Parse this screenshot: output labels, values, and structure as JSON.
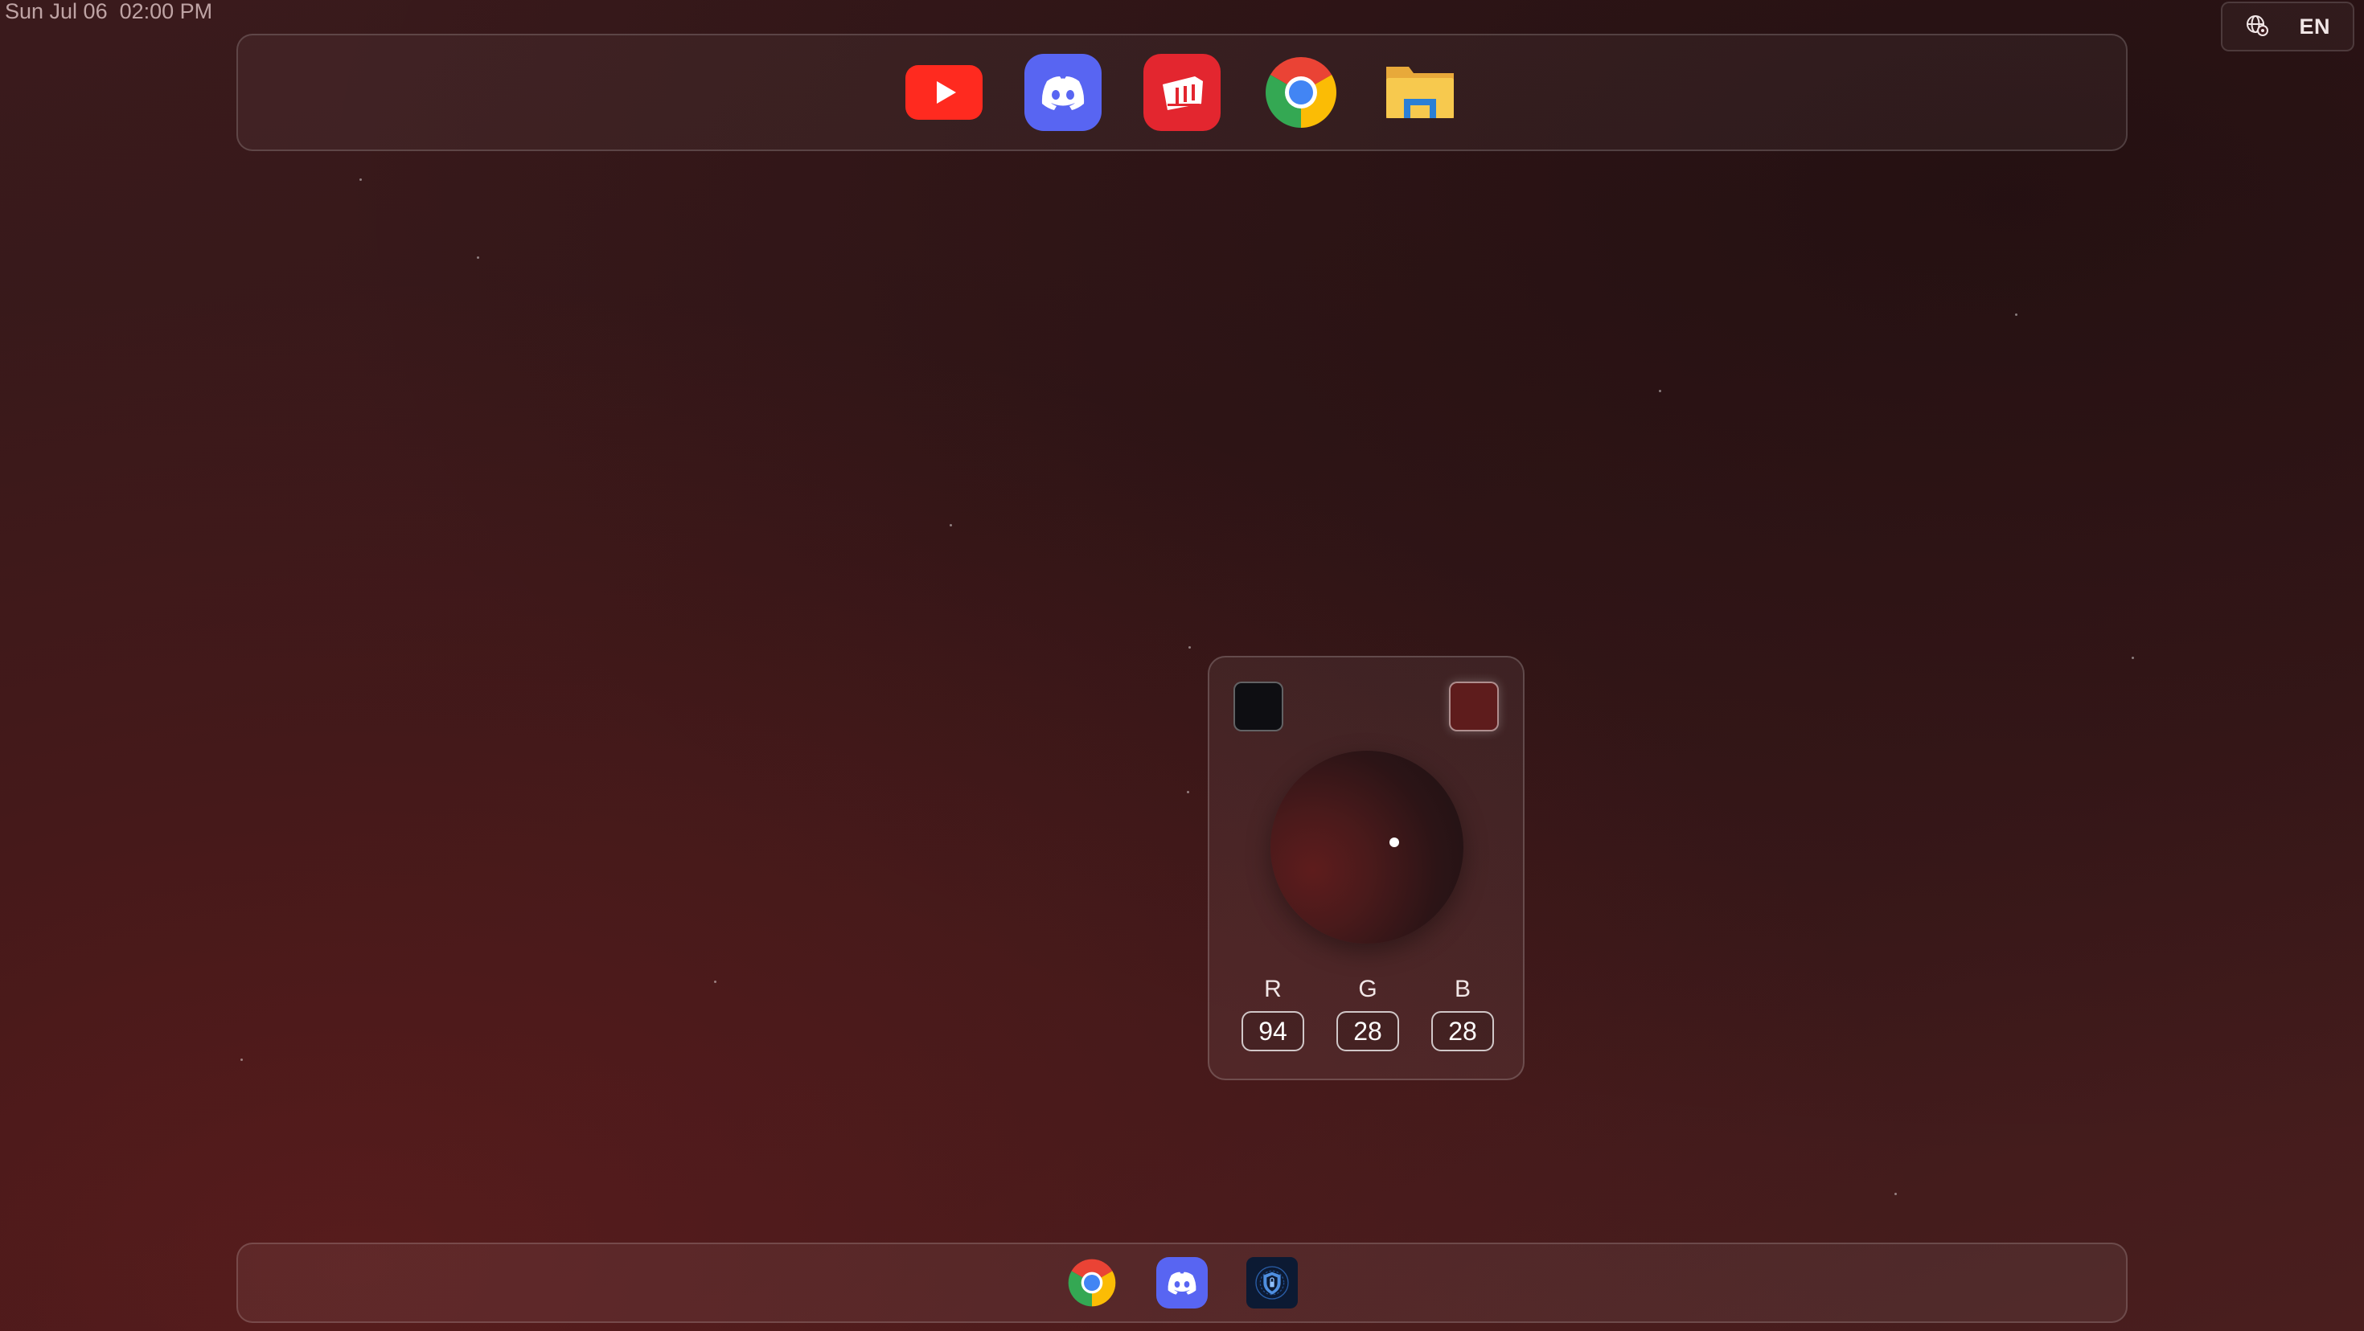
{
  "status_bar": {
    "clock": "Sun Jul 06  02:00 PM",
    "language": {
      "code": "EN",
      "icon": "globe-settings-icon"
    }
  },
  "top_dock": {
    "apps": [
      {
        "name": "YouTube",
        "icon": "youtube-icon",
        "color": "#ff2a1f"
      },
      {
        "name": "Discord",
        "icon": "discord-icon",
        "color": "#5865f2"
      },
      {
        "name": "Riot Games",
        "icon": "riot-games-icon",
        "color": "#e3262f"
      },
      {
        "name": "Google Chrome",
        "icon": "chrome-icon",
        "color": "#4285f4"
      },
      {
        "name": "File Explorer",
        "icon": "file-explorer-icon",
        "color": "#f5c04a"
      }
    ]
  },
  "bottom_dock": {
    "apps": [
      {
        "name": "Google Chrome",
        "icon": "chrome-icon"
      },
      {
        "name": "Discord",
        "icon": "discord-icon"
      },
      {
        "name": "Security",
        "icon": "shield-app-icon"
      }
    ]
  },
  "color_picker": {
    "swatch_left": {
      "icon": "swatch-black",
      "color": "#0e0e12"
    },
    "swatch_right": {
      "icon": "swatch-selected",
      "color": "#5e1c1c"
    },
    "channels": [
      {
        "label": "R",
        "value": "94"
      },
      {
        "label": "G",
        "value": "28"
      },
      {
        "label": "B",
        "value": "28"
      }
    ]
  }
}
